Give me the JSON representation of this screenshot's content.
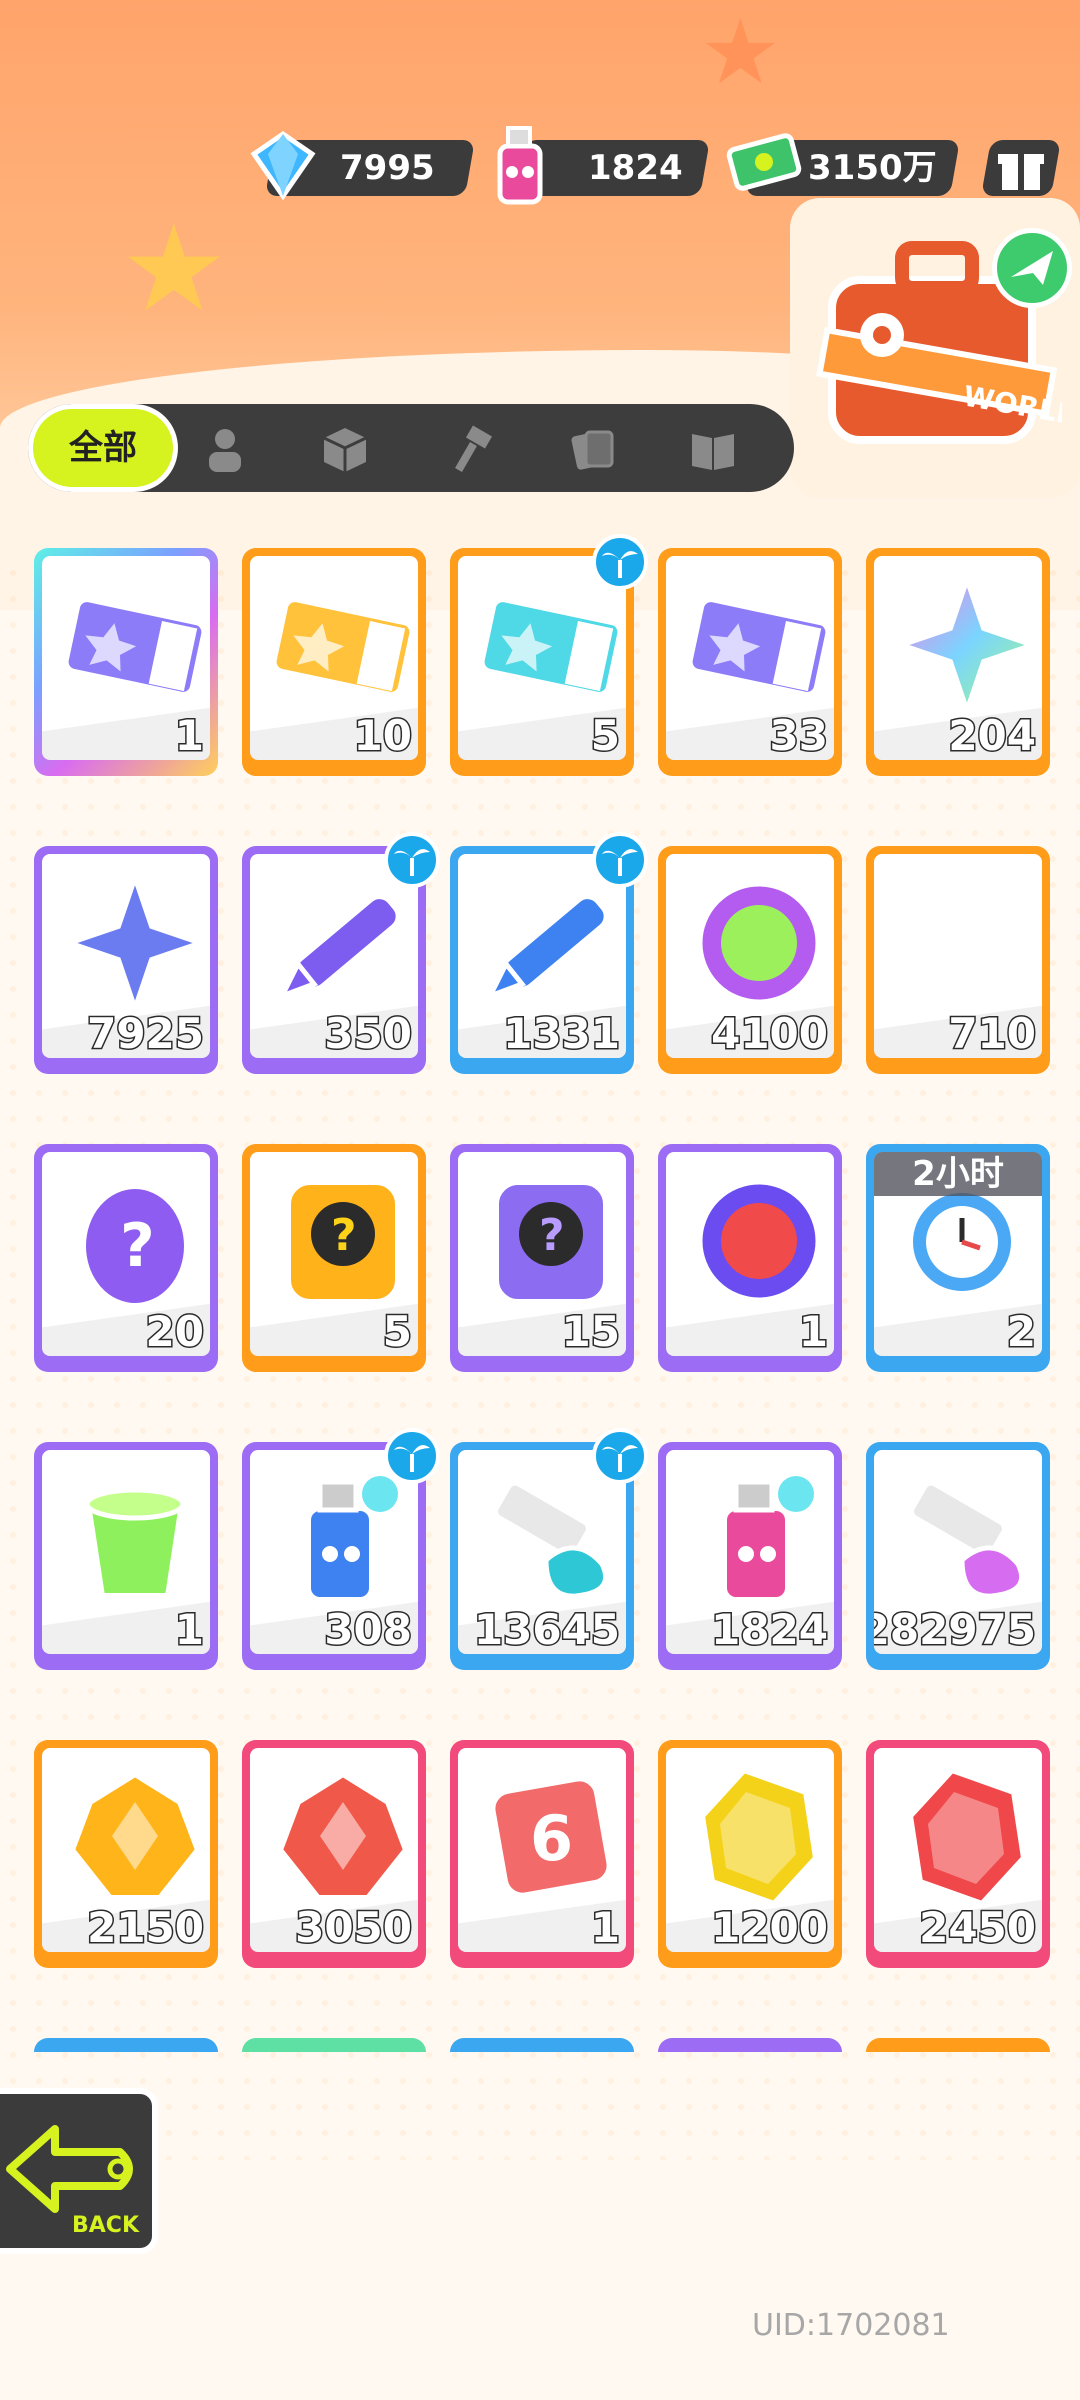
{
  "currencies": [
    {
      "name": "diamond",
      "icon": "diamond-icon",
      "value": "7995"
    },
    {
      "name": "spray",
      "icon": "spray-can-icon",
      "value": "1824"
    },
    {
      "name": "cash",
      "icon": "cash-icon",
      "value": "3150万"
    }
  ],
  "tabs": {
    "all_label": "全部",
    "icons": [
      "person-icon",
      "box-icon",
      "hammer-icon",
      "card-icon",
      "book-icon"
    ]
  },
  "items": [
    {
      "name": "ticket-purple-crown",
      "count": "1",
      "frame": "rainbow"
    },
    {
      "name": "ticket-gold-star",
      "count": "10",
      "frame": "orange"
    },
    {
      "name": "ticket-wave-up",
      "count": "5",
      "frame": "orange",
      "badge": true
    },
    {
      "name": "ticket-purple-star",
      "count": "33",
      "frame": "orange"
    },
    {
      "name": "rainbow-star",
      "count": "204",
      "frame": "orange"
    },
    {
      "name": "blue-star",
      "count": "7925",
      "frame": "purple"
    },
    {
      "name": "purple-crayon",
      "count": "350",
      "frame": "purple",
      "badge": true
    },
    {
      "name": "blue-crayon",
      "count": "1331",
      "frame": "blue",
      "badge": true
    },
    {
      "name": "cool-token",
      "count": "4100",
      "frame": "orange"
    },
    {
      "name": "season-ticket",
      "count": "710",
      "frame": "orange"
    },
    {
      "name": "mystery-egg",
      "count": "20",
      "frame": "purple"
    },
    {
      "name": "deity-card-gold",
      "count": "5",
      "frame": "orange"
    },
    {
      "name": "deity-card-purple",
      "count": "15",
      "frame": "purple"
    },
    {
      "name": "piranha-coin",
      "count": "1",
      "frame": "purple"
    },
    {
      "name": "alarm-clock",
      "count": "2",
      "frame": "blue",
      "timer": "2小时"
    },
    {
      "name": "open-jelly-cup",
      "count": "1",
      "frame": "purple"
    },
    {
      "name": "spray-can-blue",
      "count": "308",
      "frame": "purple",
      "badge": true
    },
    {
      "name": "paint-tube-blue",
      "count": "13645",
      "frame": "blue",
      "badge": true
    },
    {
      "name": "spray-can-pink",
      "count": "1824",
      "frame": "purple"
    },
    {
      "name": "paint-tube-rainbow",
      "count": "282975",
      "frame": "blue"
    },
    {
      "name": "yellow-crystal",
      "count": "2150",
      "frame": "orange"
    },
    {
      "name": "red-crystal",
      "count": "3050",
      "frame": "pink"
    },
    {
      "name": "red-die",
      "count": "1",
      "frame": "pink"
    },
    {
      "name": "yellow-gem",
      "count": "1200",
      "frame": "orange"
    },
    {
      "name": "red-gem",
      "count": "2450",
      "frame": "pink"
    }
  ],
  "next_row_frames": [
    "blue",
    "green",
    "blue",
    "purple",
    "orange"
  ],
  "back": {
    "label": "BACK"
  },
  "case": {
    "label": "WORLD"
  },
  "uid": "UID:1702081",
  "colors": {
    "orange": "#ff9c1a",
    "purple": "#9c6cf5",
    "blue": "#3aa7f0",
    "pink": "#f24a7a",
    "green": "#5ee0a4",
    "accent": "#d6f21f"
  }
}
